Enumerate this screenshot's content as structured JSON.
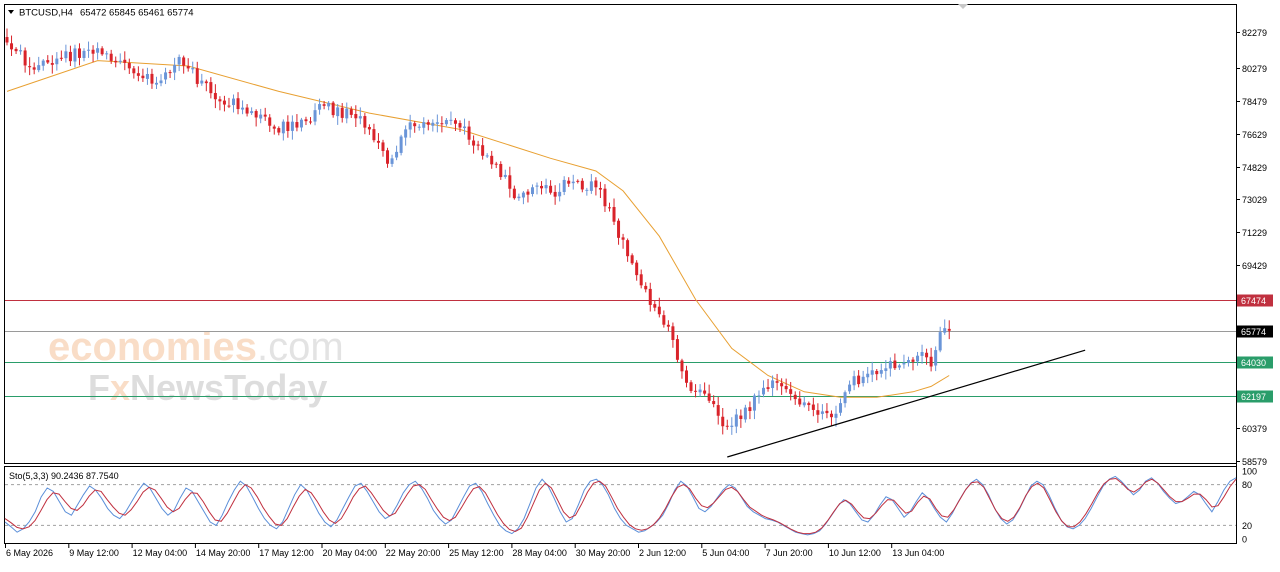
{
  "header": {
    "symbol": "BTCUSD,H4",
    "ohlc": "65472 65845 65461 65774"
  },
  "watermark": {
    "line1_a": "economies",
    "line1_b": ".com",
    "line2_a": "F",
    "line2_b": "x",
    "line2_c": "NewsToday"
  },
  "colors": {
    "bull": "#6a95d8",
    "bear": "#d9232a",
    "ma": "#e8a032",
    "resistance": "#c0303f",
    "support": "#2a9d6a",
    "current": "#9a9a9a",
    "trendline": "#000000",
    "sto_main": "#5b8fd9",
    "sto_signal": "#c0303f"
  },
  "chart_data": [
    {
      "type": "candlestick",
      "timeframe": "H4",
      "ylim": [
        58579,
        82279
      ],
      "price_ticks": [
        82279,
        80279,
        78479,
        76629,
        74829,
        73029,
        71229,
        69429,
        60379,
        58579
      ],
      "x_labels": [
        "6 May 2026",
        "9 May 12:00",
        "12 May 04:00",
        "14 May 20:00",
        "17 May 12:00",
        "20 May 04:00",
        "22 May 20:00",
        "25 May 12:00",
        "28 May 04:00",
        "30 May 20:00",
        "2 Jun 12:00",
        "5 Jun 04:00",
        "7 Jun 20:00",
        "10 Jun 12:00",
        "13 Jun 04:00"
      ],
      "close_anchors": [
        [
          0,
          81700
        ],
        [
          6,
          80200
        ],
        [
          12,
          80800
        ],
        [
          18,
          81300
        ],
        [
          24,
          80600
        ],
        [
          28,
          80000
        ],
        [
          34,
          79600
        ],
        [
          38,
          80900
        ],
        [
          45,
          78900
        ],
        [
          52,
          78100
        ],
        [
          58,
          77100
        ],
        [
          64,
          77000
        ],
        [
          70,
          78200
        ],
        [
          76,
          77700
        ],
        [
          80,
          76900
        ],
        [
          84,
          75000
        ],
        [
          88,
          76900
        ],
        [
          92,
          77300
        ],
        [
          96,
          77200
        ],
        [
          100,
          77000
        ],
        [
          104,
          76000
        ],
        [
          108,
          75000
        ],
        [
          112,
          73100
        ],
        [
          116,
          73700
        ],
        [
          120,
          73400
        ],
        [
          124,
          73900
        ],
        [
          130,
          73700
        ],
        [
          134,
          71800
        ],
        [
          138,
          69500
        ],
        [
          142,
          67200
        ],
        [
          146,
          66000
        ],
        [
          150,
          62900
        ],
        [
          154,
          62300
        ],
        [
          158,
          60500
        ],
        [
          162,
          60900
        ],
        [
          166,
          62200
        ],
        [
          170,
          62900
        ],
        [
          174,
          62000
        ],
        [
          178,
          61400
        ],
        [
          182,
          61000
        ],
        [
          186,
          62800
        ],
        [
          190,
          63400
        ],
        [
          194,
          63700
        ],
        [
          198,
          64000
        ],
        [
          202,
          64600
        ],
        [
          204,
          63800
        ],
        [
          206,
          65700
        ],
        [
          208,
          65774
        ]
      ],
      "moving_average": [
        [
          0,
          79000
        ],
        [
          20,
          80700
        ],
        [
          40,
          80400
        ],
        [
          60,
          79000
        ],
        [
          80,
          77800
        ],
        [
          100,
          76900
        ],
        [
          120,
          75300
        ],
        [
          130,
          74600
        ],
        [
          136,
          73500
        ],
        [
          144,
          71000
        ],
        [
          152,
          67500
        ],
        [
          160,
          64800
        ],
        [
          168,
          63300
        ],
        [
          176,
          62400
        ],
        [
          184,
          62100
        ],
        [
          192,
          62100
        ],
        [
          200,
          62400
        ],
        [
          204,
          62700
        ],
        [
          208,
          63300
        ]
      ],
      "horizontal_levels": [
        {
          "value": 67474,
          "role": "resistance"
        },
        {
          "value": 65774,
          "role": "current"
        },
        {
          "value": 64030,
          "role": "support"
        },
        {
          "value": 62197,
          "role": "support"
        }
      ],
      "trendline": {
        "from": [
          159,
          58800
        ],
        "to": [
          238,
          64700
        ]
      },
      "last_index": 208
    },
    {
      "type": "line",
      "label": "Sto(5,3,3) 90.2436 87.7540",
      "ylim": [
        0,
        100
      ],
      "ticks": [
        100,
        80,
        20,
        0
      ],
      "levels": [
        80,
        20
      ],
      "series": [
        {
          "role": "main",
          "values": [
            25,
            18,
            10,
            15,
            25,
            40,
            62,
            75,
            70,
            55,
            40,
            35,
            50,
            65,
            78,
            72,
            60,
            45,
            35,
            30,
            40,
            55,
            70,
            82,
            75,
            60,
            45,
            35,
            42,
            60,
            75,
            70,
            55,
            40,
            25,
            20,
            35,
            55,
            72,
            85,
            78,
            62,
            45,
            30,
            20,
            15,
            25,
            45,
            65,
            80,
            72,
            55,
            38,
            25,
            18,
            28,
            45,
            62,
            78,
            82,
            70,
            55,
            40,
            30,
            35,
            50,
            68,
            80,
            85,
            75,
            60,
            42,
            30,
            22,
            28,
            45,
            62,
            78,
            82,
            70,
            52,
            35,
            20,
            12,
            8,
            15,
            30,
            52,
            75,
            88,
            78,
            60,
            40,
            25,
            30,
            50,
            72,
            85,
            88,
            80,
            65,
            45,
            30,
            20,
            15,
            10,
            12,
            18,
            25,
            35,
            52,
            72,
            85,
            78,
            62,
            45,
            40,
            48,
            60,
            72,
            80,
            75,
            62,
            48,
            40,
            35,
            30,
            28,
            25,
            20,
            15,
            10,
            8,
            6,
            8,
            12,
            22,
            35,
            48,
            58,
            52,
            40,
            28,
            25,
            35,
            50,
            62,
            58,
            45,
            32,
            40,
            55,
            68,
            60,
            45,
            32,
            25,
            38,
            55,
            70,
            82,
            88,
            80,
            65,
            45,
            30,
            22,
            28,
            42,
            60,
            78,
            85,
            80,
            65,
            45,
            28,
            18,
            15,
            20,
            30,
            45,
            62,
            78,
            88,
            92,
            85,
            75,
            65,
            72,
            85,
            90,
            82,
            70,
            60,
            52,
            55,
            62,
            70,
            65,
            52,
            40,
            55,
            72,
            85,
            90
          ]
        },
        {
          "role": "signal",
          "values": [
            30,
            24,
            17,
            15,
            18,
            27,
            42,
            58,
            68,
            66,
            55,
            45,
            42,
            50,
            63,
            72,
            70,
            58,
            47,
            38,
            35,
            43,
            55,
            69,
            76,
            72,
            60,
            47,
            40,
            45,
            58,
            68,
            67,
            55,
            40,
            28,
            26,
            38,
            54,
            70,
            80,
            75,
            62,
            46,
            33,
            22,
            20,
            30,
            47,
            63,
            73,
            68,
            55,
            40,
            28,
            23,
            30,
            45,
            62,
            74,
            78,
            68,
            55,
            42,
            34,
            38,
            52,
            66,
            78,
            80,
            73,
            58,
            44,
            32,
            27,
            32,
            46,
            61,
            74,
            77,
            68,
            52,
            36,
            23,
            14,
            11,
            16,
            32,
            52,
            72,
            82,
            75,
            58,
            40,
            31,
            35,
            51,
            69,
            82,
            85,
            78,
            62,
            45,
            32,
            21,
            15,
            13,
            15,
            21,
            31,
            45,
            62,
            76,
            80,
            74,
            60,
            49,
            46,
            53,
            63,
            73,
            76,
            70,
            58,
            47,
            41,
            35,
            31,
            28,
            24,
            19,
            14,
            10,
            8,
            8,
            10,
            16,
            27,
            40,
            52,
            57,
            51,
            40,
            31,
            30,
            38,
            49,
            58,
            57,
            47,
            38,
            41,
            54,
            63,
            59,
            45,
            34,
            32,
            43,
            58,
            73,
            83,
            84,
            76,
            59,
            42,
            30,
            26,
            32,
            46,
            64,
            77,
            82,
            75,
            58,
            40,
            26,
            18,
            18,
            25,
            37,
            52,
            68,
            81,
            88,
            89,
            82,
            73,
            69,
            75,
            84,
            88,
            82,
            72,
            62,
            55,
            55,
            60,
            66,
            66,
            58,
            47,
            49,
            62,
            77,
            88
          ]
        }
      ]
    }
  ]
}
